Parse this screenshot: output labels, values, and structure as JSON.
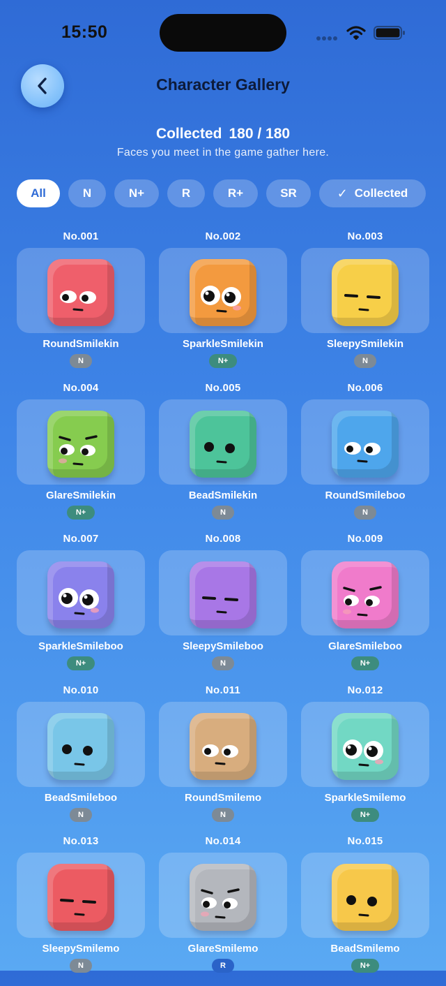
{
  "status": {
    "time": "15:50"
  },
  "header": {
    "title": "Character Gallery"
  },
  "summary": {
    "label": "Collected",
    "count": "180 / 180",
    "subtitle": "Faces you meet in the game gather here."
  },
  "filters": [
    {
      "label": "All",
      "active": true
    },
    {
      "label": "N"
    },
    {
      "label": "N+"
    },
    {
      "label": "R"
    },
    {
      "label": "R+"
    },
    {
      "label": "SR"
    },
    {
      "label": "Collected",
      "icon": "check-icon"
    }
  ],
  "rarity_colors": {
    "N": "#7d8a96",
    "N+": "#3d8c7e",
    "R": "#2a63c8"
  },
  "characters": [
    {
      "no": "No.001",
      "name": "RoundSmilekin",
      "rarity": "N",
      "color": "#ef5f6b",
      "face": "round"
    },
    {
      "no": "No.002",
      "name": "SparkleSmilekin",
      "rarity": "N+",
      "color": "#f39a3f",
      "face": "sparkle"
    },
    {
      "no": "No.003",
      "name": "SleepySmilekin",
      "rarity": "N",
      "color": "#f7cf48",
      "face": "sleepy"
    },
    {
      "no": "No.004",
      "name": "GlareSmilekin",
      "rarity": "N+",
      "color": "#86cc4f",
      "face": "glare"
    },
    {
      "no": "No.005",
      "name": "BeadSmilekin",
      "rarity": "N",
      "color": "#4dc49a",
      "face": "bead"
    },
    {
      "no": "No.006",
      "name": "RoundSmileboo",
      "rarity": "N",
      "color": "#4ea6ec",
      "face": "round"
    },
    {
      "no": "No.007",
      "name": "SparkleSmileboo",
      "rarity": "N+",
      "color": "#8a82ec",
      "face": "sparkle"
    },
    {
      "no": "No.008",
      "name": "SleepySmileboo",
      "rarity": "N",
      "color": "#a877e6",
      "face": "sleepy"
    },
    {
      "no": "No.009",
      "name": "GlareSmileboo",
      "rarity": "N+",
      "color": "#f07bcb",
      "face": "glare"
    },
    {
      "no": "No.010",
      "name": "BeadSmileboo",
      "rarity": "N",
      "color": "#79c6e8",
      "face": "bead"
    },
    {
      "no": "No.011",
      "name": "RoundSmilemo",
      "rarity": "N",
      "color": "#d8ad7e",
      "face": "round"
    },
    {
      "no": "No.012",
      "name": "SparkleSmilemo",
      "rarity": "N+",
      "color": "#72d8c4",
      "face": "sparkle"
    },
    {
      "no": "No.013",
      "name": "SleepySmilemo",
      "rarity": "N",
      "color": "#ec5b62",
      "face": "sleepy"
    },
    {
      "no": "No.014",
      "name": "GlareSmilemo",
      "rarity": "R",
      "color": "#b4b7bd",
      "face": "glare"
    },
    {
      "no": "No.015",
      "name": "BeadSmilemo",
      "rarity": "N+",
      "color": "#f7c84a",
      "face": "bead"
    }
  ]
}
